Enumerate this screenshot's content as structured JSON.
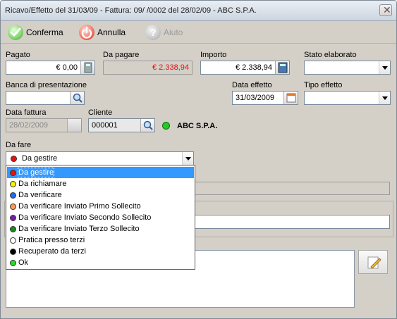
{
  "window": {
    "title": "Ricavo/Effetto del 31/03/09 - Fattura: 09/  /0002 del 28/02/09 - ABC S.P.A.",
    "close_glyph": "✕"
  },
  "toolbar": {
    "confirm_label": "Conferma",
    "cancel_label": "Annulla",
    "help_label": "Aiuto",
    "confirm_icon": "check-icon",
    "cancel_icon": "power-icon",
    "help_icon": "help-icon"
  },
  "form": {
    "pagato_label": "Pagato",
    "pagato_value": "€ 0,00",
    "da_pagare_label": "Da pagare",
    "da_pagare_value": "€ 2.338,94",
    "importo_label": "Importo",
    "importo_value": "€ 2.338,94",
    "stato_label": "Stato elaborato",
    "stato_value": "",
    "banca_label": "Banca di presentazione",
    "banca_value": "",
    "data_effetto_label": "Data effetto",
    "data_effetto_value": "31/03/2009",
    "tipo_effetto_label": "Tipo effetto",
    "tipo_effetto_value": "",
    "data_fattura_label": "Data fattura",
    "data_fattura_value": "28/02/2009",
    "cliente_label": "Cliente",
    "cliente_value": "000001",
    "cliente_name": "ABC S.P.A.",
    "cliente_status_color": "#22cc22",
    "da_fare_label": "Da fare",
    "da_fare_value": "Da gestire",
    "da_fare_color": "#e81010"
  },
  "colors": {
    "accent_selection": "#3399ff",
    "amount_due": "#e01010"
  },
  "dropdown": {
    "selected_index": 0,
    "options": [
      {
        "label": "Da gestire",
        "color": "#e81010"
      },
      {
        "label": "Da richiamare",
        "color": "#f2f200"
      },
      {
        "label": "Da verificare",
        "color": "#1a6cff"
      },
      {
        "label": "Da verificare Inviato Primo Sollecito",
        "color": "#ff9955"
      },
      {
        "label": "Da verificare Inviato Secondo Sollecito",
        "color": "#7a1aa8"
      },
      {
        "label": "Da verificare Inviato Terzo Sollecito",
        "color": "#1a8a1a"
      },
      {
        "label": "Pratica presso terzi",
        "color": "#ffffff"
      },
      {
        "label": "Recuperato da terzi",
        "color": "#000000"
      },
      {
        "label": "Ok",
        "color": "#22dd22"
      }
    ]
  }
}
